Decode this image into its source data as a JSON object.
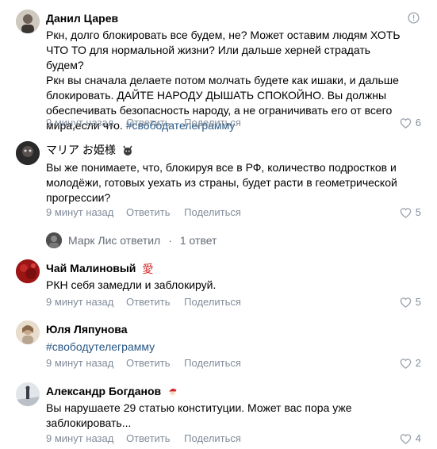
{
  "comments": [
    {
      "author": "Данил Царев",
      "lines": [
        "Ркн, долго блокировать все будем, не? Может оставим людям ХОТЬ",
        "ЧТО ТО для нормальной жизни? Или дальше херней страдать будем?",
        "Ркн вы сначала делаете потом молчать будете как ишаки, и дальше",
        "блокировать. ДАЙТЕ НАРОДУ ДЫШАТЬ СПОКОЙНО. Вы должны",
        "обеспечивать безопасность народу, а не ограничивать его от всего"
      ],
      "last_line": "мира,если что.",
      "hashtag": "#свободателеграмму",
      "time": "9 минут назад",
      "reply": "Ответить",
      "share": "Поделиться",
      "likes": "6"
    },
    {
      "author": "マリア お姫様",
      "lines": [
        "Вы же понимаете, что, блокируя все в РФ, количество подростков и",
        "молодёжи, готовых уехать из страны, будет расти в геометрической",
        "прогрессии?"
      ],
      "time": "9 минут назад",
      "reply": "Ответить",
      "share": "Поделиться",
      "likes": "5"
    },
    {
      "author": "Чай Малиновый",
      "emoji": "愛",
      "lines": [
        "РКН себя замедли и заблокируй."
      ],
      "time": "9 минут назад",
      "reply": "Ответить",
      "share": "Поделиться",
      "likes": "5"
    },
    {
      "author": "Юля Ляпунова",
      "hashtag": "#свободутелеграмму",
      "time": "9 минут назад",
      "reply": "Ответить",
      "share": "Поделиться",
      "likes": "2"
    },
    {
      "author": "Александр Богданов",
      "lines": [
        "Вы нарушаете 29 статью конституции. Может вас пора уже",
        "заблокировать..."
      ],
      "time": "9 минут назад",
      "reply": "Ответить",
      "share": "Поделиться",
      "likes": "4"
    }
  ],
  "thread": {
    "replied": "Марк Лис ответил",
    "count": "1 ответ"
  },
  "colors": {
    "link": "#2a5885",
    "meta": "#818c99"
  }
}
